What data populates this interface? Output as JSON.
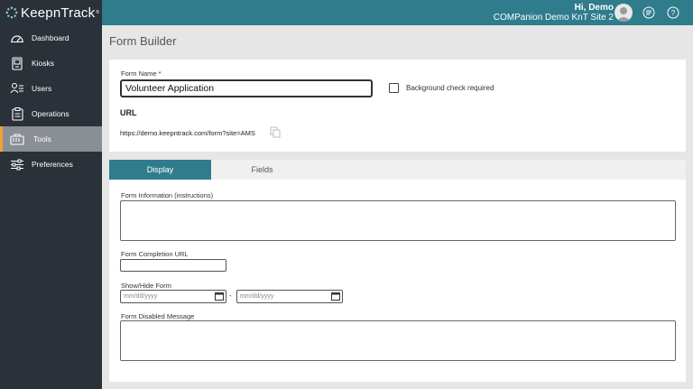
{
  "app": {
    "brand": "KeepnTrack",
    "trademark": "®"
  },
  "header": {
    "greeting": "Hi, Demo",
    "site": "COMPanion Demo KnT Site 2"
  },
  "sidebar": {
    "items": [
      {
        "label": "Dashboard",
        "icon": "gauge-icon",
        "active": false
      },
      {
        "label": "Kiosks",
        "icon": "kiosk-icon",
        "active": false
      },
      {
        "label": "Users",
        "icon": "users-icon",
        "active": false
      },
      {
        "label": "Operations",
        "icon": "clipboard-icon",
        "active": false
      },
      {
        "label": "Tools",
        "icon": "tools-icon",
        "active": true
      },
      {
        "label": "Preferences",
        "icon": "sliders-icon",
        "active": false
      }
    ]
  },
  "page": {
    "title": "Form Builder"
  },
  "form": {
    "name_label": "Form Name *",
    "name_value": "Volunteer Application",
    "background_check_label": "Background check required",
    "background_check_checked": false,
    "url_heading": "URL",
    "url_value": "https://demo.keepntrack.com/form?site=AMS"
  },
  "tabs": [
    {
      "label": "Display",
      "active": true
    },
    {
      "label": "Fields",
      "active": false
    }
  ],
  "display": {
    "instructions_label": "Form Information (instructions)",
    "completion_url_label": "Form Completion URL",
    "show_hide_label": "Show/Hide Form",
    "date_placeholder": "mm/dd/yyyy",
    "range_separator": "-",
    "disabled_message_label": "Form Disabled Message"
  },
  "colors": {
    "header": "#2f7c8c",
    "sidebar": "#2b3138",
    "active_accent": "#f1a13a",
    "tab_active": "#2f7c8c"
  }
}
